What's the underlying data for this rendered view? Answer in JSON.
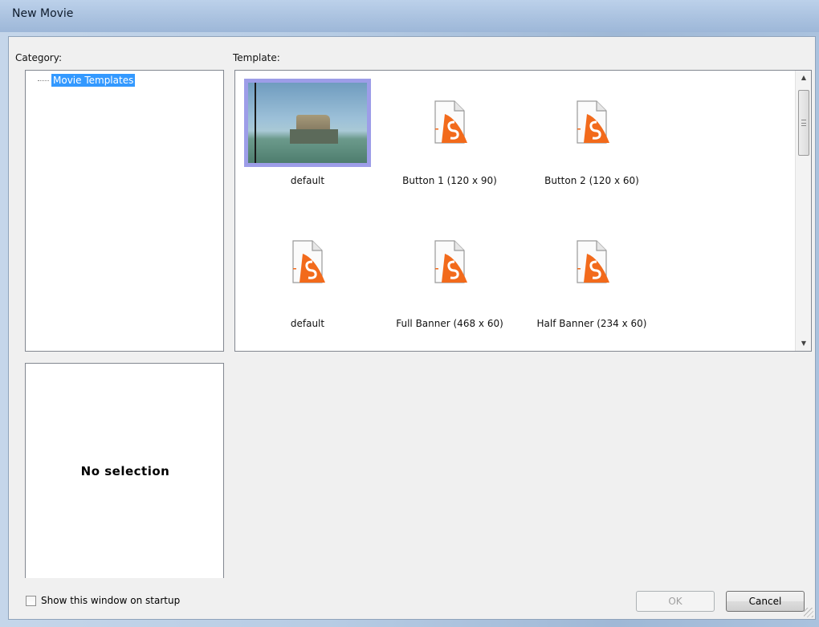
{
  "window": {
    "title": "New Movie"
  },
  "category": {
    "label": "Category:",
    "items": [
      {
        "label": "Movie Templates",
        "selected": true
      }
    ]
  },
  "template": {
    "label": "Template:",
    "items": [
      {
        "caption": "default",
        "icon": "photo-thumbnail",
        "selected": true
      },
      {
        "caption": "Button 1 (120 x 90)",
        "icon": "swf-file-icon"
      },
      {
        "caption": "Button 2 (120 x 60)",
        "icon": "swf-file-icon"
      },
      {
        "caption": "default",
        "icon": "swf-file-icon"
      },
      {
        "caption": "Full Banner (468 x 60)",
        "icon": "swf-file-icon"
      },
      {
        "caption": "Half Banner (234 x 60)",
        "icon": "swf-file-icon"
      }
    ]
  },
  "preview": {
    "text": "No selection"
  },
  "startup": {
    "label": "Show this window on startup",
    "checked": false
  },
  "buttons": {
    "ok": "OK",
    "cancel": "Cancel"
  },
  "colors": {
    "selection": "#3399ff",
    "thumb_highlight": "#9d9de8",
    "accent_orange": "#f26a1b"
  }
}
